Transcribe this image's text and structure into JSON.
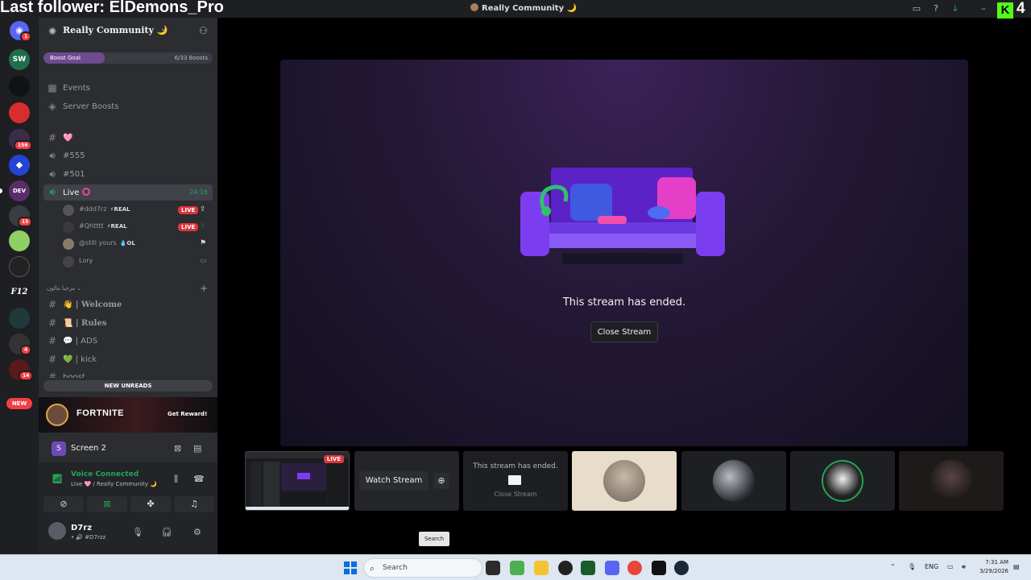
{
  "overlay": {
    "follower_text": "Last follower: ElDemons_Pro",
    "kick_count": "4"
  },
  "window": {
    "title": "Really Community 🌙"
  },
  "guilds": {
    "items": [
      {
        "label": "SW",
        "color": "#1f6f4a"
      },
      {
        "label": "",
        "color": "#111214"
      },
      {
        "label": "",
        "color": "#d62d2d"
      },
      {
        "label": "",
        "color": "#3a2d4a"
      },
      {
        "label": "",
        "color": "#2444d6"
      },
      {
        "label": "DEV",
        "color": "#5a2d6a"
      },
      {
        "label": "",
        "color": "#3a3c43"
      },
      {
        "label": "",
        "color": "#8fcf63"
      },
      {
        "label": "",
        "color": "#222"
      },
      {
        "label": "F12",
        "color": "#1e1f22"
      },
      {
        "label": "",
        "color": "#1f3a3a"
      },
      {
        "label": "",
        "color": "#333"
      },
      {
        "label": "",
        "color": "#5a1a1a"
      }
    ],
    "badges": [
      "1",
      "156",
      "15",
      "4",
      "14"
    ],
    "new_label": "NEW"
  },
  "server": {
    "name": "Really Community 🌙",
    "boost": {
      "label": "Boost Goal",
      "count": "6/33 Boosts",
      "progress": 0.18
    },
    "links": [
      "Events",
      "Server Boosts"
    ],
    "channels": [
      {
        "name": "🩷",
        "kind": "text"
      },
      {
        "name": "#555",
        "kind": "voice"
      },
      {
        "name": "#501",
        "kind": "voice"
      },
      {
        "name": "Live",
        "kind": "voice",
        "time": "24:16"
      }
    ],
    "voice_users": [
      {
        "name": "#ddd7rz",
        "tag": "⚡REAL",
        "live": "LIVE"
      },
      {
        "name": "#Qhtttt",
        "tag": "⚡REAL",
        "live": "LIVE"
      },
      {
        "name": "@still yours",
        "tag": "💧OL"
      },
      {
        "name": "Lory"
      }
    ],
    "category": "مرحبا مالون",
    "category_channels": [
      "👋 | Welcome",
      "📜 | Rules",
      "💬 | ADS",
      "💚 | kick",
      "boost"
    ],
    "new_unreads": "NEW UNREADS"
  },
  "promo": {
    "title": "FORTNITE",
    "cta": "Get Reward!"
  },
  "screenshare": {
    "label": "Screen 2"
  },
  "voice": {
    "status": "Voice Connected",
    "location": "Live 🩷 / Really Community 🌙"
  },
  "me": {
    "name": "D7rz",
    "status": "• 🔊 #D7rzz"
  },
  "stage": {
    "ended_text": "This stream has ended.",
    "close_label": "Close Stream"
  },
  "tiles": {
    "live_badge": "LIVE",
    "watch_label": "Watch Stream",
    "ended_small": "This stream has ended.",
    "close_small": "Close Stream"
  },
  "tooltip": "Search",
  "taskbar": {
    "search_placeholder": "Search",
    "lang": "ENG",
    "time": "7:31 AM",
    "date": "3/29/2026"
  }
}
